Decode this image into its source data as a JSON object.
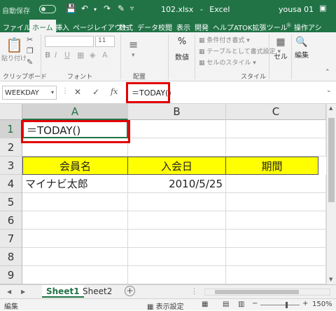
{
  "titlebar": {
    "autosave": "自動保存",
    "autosave_state": "オフ",
    "filename": "102.xlsx",
    "separator": "-",
    "app": "Excel",
    "user": "yousa 01"
  },
  "menu": {
    "items": [
      "ファイル",
      "ホーム",
      "挿入",
      "ページレイアウト",
      "数式",
      "データ",
      "校閲",
      "表示",
      "開発",
      "ヘルプ",
      "ATOK拡張ツール"
    ],
    "active": "ホーム",
    "help_search": "操作アシ"
  },
  "ribbon": {
    "clipboard_label": "クリップボード",
    "paste_label": "貼り付け",
    "font_label": "フォント",
    "font_size": "11",
    "align_label": "配置",
    "number_label": "数値",
    "percent": "%",
    "style_label": "スタイル",
    "cond_format": "条件付き書式",
    "table_format": "テーブルとして書式設定",
    "cell_style": "セルのスタイル",
    "cells_label": "セル",
    "edit_label": "編集"
  },
  "formula_bar": {
    "name_box": "WEEKDAY",
    "formula": "＝TODAY()"
  },
  "grid": {
    "columns": [
      "A",
      "B",
      "C"
    ],
    "rows": [
      "1",
      "2",
      "3",
      "4",
      "5",
      "6",
      "7",
      "8",
      "9"
    ],
    "a1": "＝TODAY()",
    "header_member": "会員名",
    "header_join_date": "入会日",
    "header_period": "期間",
    "member_name": "マイナビ太郎",
    "join_date": "2010/5/25"
  },
  "sheets": {
    "tabs": [
      "Sheet1",
      "Sheet2"
    ],
    "active": "Sheet1"
  },
  "status": {
    "mode": "編集",
    "display_settings": "表示設定",
    "zoom": "150%"
  },
  "colors": {
    "excel_green": "#217346",
    "highlight_red": "#e30000",
    "header_fill": "#ffff00"
  }
}
